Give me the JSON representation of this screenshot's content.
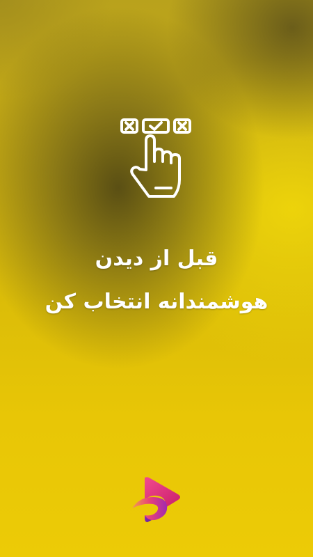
{
  "screen": {
    "headline": {
      "line1": "قبل از دیدن",
      "line2": "هوشمندانه انتخاب کن"
    },
    "icons": {
      "hero": "hand-selecting-checkbox-icon",
      "logo": "brand-play-logo-icon"
    },
    "colors": {
      "background_yellow": "#e3c40a",
      "background_dark": "#463e14",
      "text": "#ffffff",
      "logo_pink": "#e0247a",
      "logo_orange": "#f08a3c",
      "logo_purple": "#7b2ab8"
    }
  }
}
